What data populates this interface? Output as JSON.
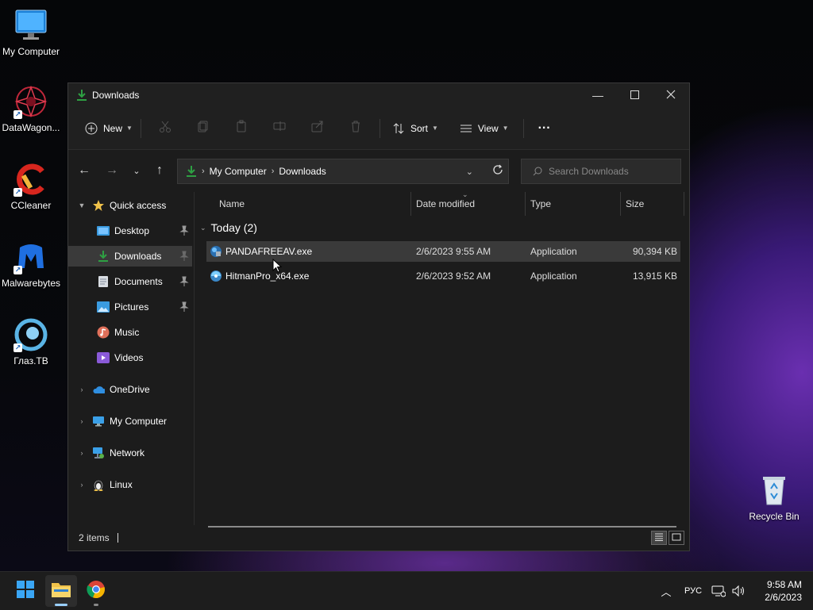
{
  "desktop": {
    "icons": [
      {
        "label": "My Computer"
      },
      {
        "label": "DataWagon..."
      },
      {
        "label": "CCleaner"
      },
      {
        "label": "Malwarebytes"
      },
      {
        "label": "Глаз.ТВ"
      },
      {
        "label": "Recycle Bin"
      }
    ]
  },
  "window": {
    "title": "Downloads",
    "commands": {
      "new_label": "New",
      "sort_label": "Sort",
      "view_label": "View",
      "more_label": "···"
    },
    "address": {
      "crumbs": [
        "My Computer",
        "Downloads"
      ]
    },
    "search": {
      "placeholder": "Search Downloads"
    },
    "sidebar": {
      "quick_access": "Quick access",
      "items": [
        {
          "label": "Desktop"
        },
        {
          "label": "Downloads"
        },
        {
          "label": "Documents"
        },
        {
          "label": "Pictures"
        },
        {
          "label": "Music"
        },
        {
          "label": "Videos"
        }
      ],
      "roots": [
        {
          "label": "OneDrive"
        },
        {
          "label": "My Computer"
        },
        {
          "label": "Network"
        },
        {
          "label": "Linux"
        }
      ]
    },
    "columns": {
      "name": "Name",
      "date": "Date modified",
      "type": "Type",
      "size": "Size"
    },
    "group_label": "Today (2)",
    "files": [
      {
        "name": "PANDAFREEAV.exe",
        "date": "2/6/2023 9:55 AM",
        "type": "Application",
        "size": "90,394 KB"
      },
      {
        "name": "HitmanPro_x64.exe",
        "date": "2/6/2023 9:52 AM",
        "type": "Application",
        "size": "13,915 KB"
      }
    ],
    "status": "2 items"
  },
  "taskbar": {
    "language": "РУС",
    "time": "9:58 AM",
    "date": "2/6/2023"
  },
  "colors": {
    "accent": "#2ea043",
    "folder": "#f0c24a",
    "selection": "#3a3a3a"
  }
}
